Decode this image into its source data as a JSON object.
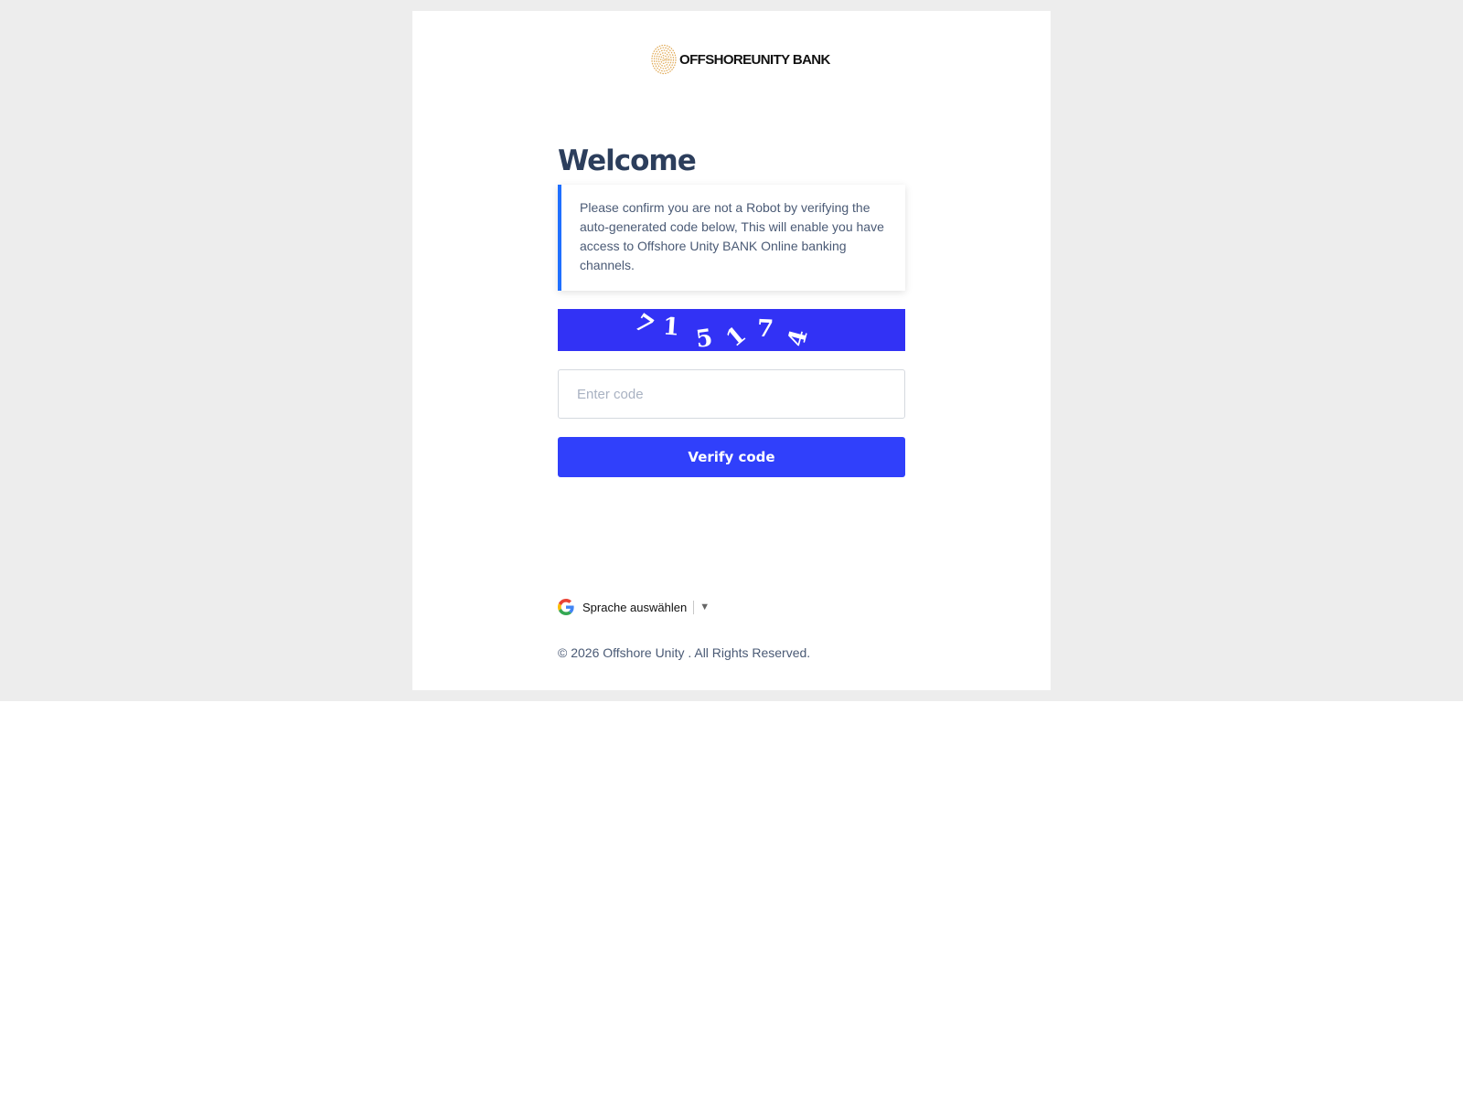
{
  "brand": {
    "name": "OFFSHOREUNITY BANK",
    "logo_icon": "fingerprint-icon",
    "logo_color": "#e0a955"
  },
  "main": {
    "heading": "Welcome",
    "notice": "Please confirm you are not a Robot by verifying the auto-generated code below, This will enable you have access to Offshore Unity BANK Online banking channels.",
    "captcha": {
      "characters": [
        "7",
        "1",
        "5",
        "1",
        "7",
        "4"
      ],
      "background": "#3232f5"
    },
    "code_input": {
      "placeholder": "Enter code",
      "value": ""
    },
    "verify_label": "Verify code"
  },
  "footer": {
    "language": {
      "icon": "google-icon",
      "label": "Sprache auswählen",
      "arrow": "▼"
    },
    "copyright": "© 2026 Offshore Unity . All Rights Reserved."
  },
  "colors": {
    "accent": "#3040fb",
    "notice_border": "#1f6fff",
    "heading": "#2c3e5c"
  }
}
